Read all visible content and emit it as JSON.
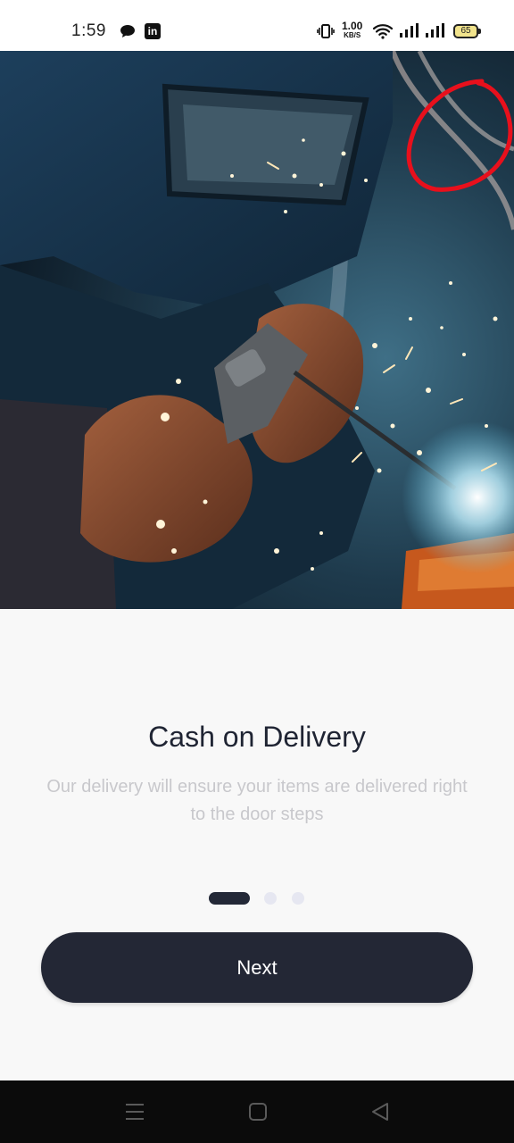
{
  "status_bar": {
    "time": "1:59",
    "net_speed_value": "1.00",
    "net_speed_unit": "KB/S",
    "battery_level": "65",
    "icons": [
      "chat-icon",
      "linkedin-icon",
      "vibrate-icon",
      "wifi-icon",
      "signal-icon",
      "signal-icon",
      "battery-icon"
    ]
  },
  "hero": {
    "image": "welder-with-sparks-photo",
    "annotation": "red-circle-marker"
  },
  "onboarding": {
    "title": "Cash on Delivery",
    "subtitle": "Our delivery will ensure your items are delivered right to the door steps",
    "pagination": {
      "current": 1,
      "total": 3
    },
    "next_label": "Next"
  },
  "nav_bar": {
    "icons": [
      "menu-icon",
      "home-icon",
      "back-icon"
    ]
  },
  "colors": {
    "primary_dark": "#232735",
    "title_text": "#1f2433",
    "subtitle_text": "#c8c8cc",
    "dot_inactive": "#e6e7f1",
    "annotation_red": "#e8101c"
  }
}
